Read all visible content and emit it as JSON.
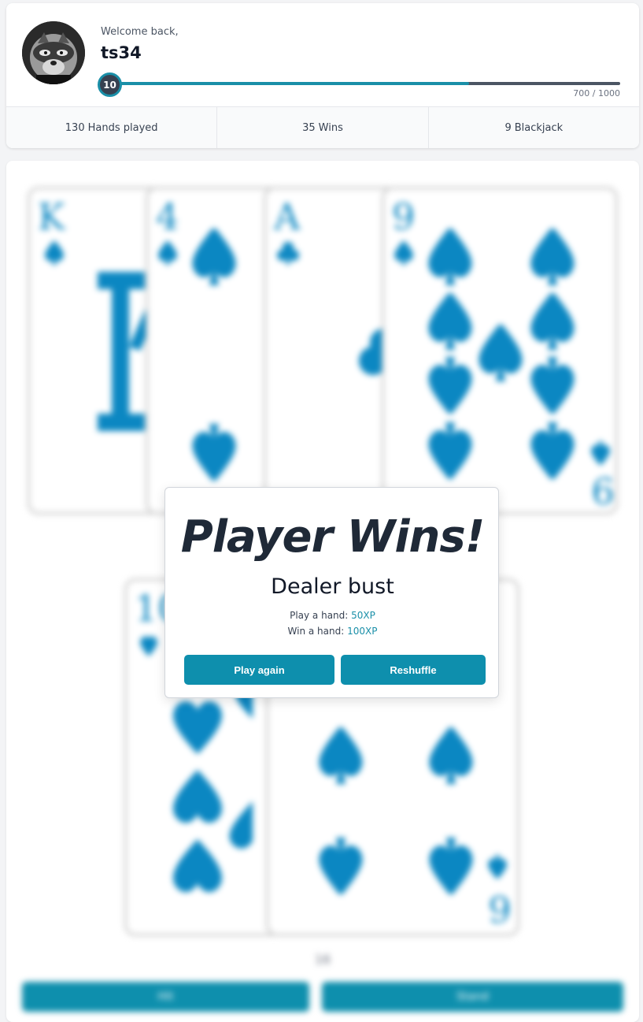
{
  "profile": {
    "welcome": "Welcome back,",
    "username": "ts34",
    "level": "10",
    "xp_current": 700,
    "xp_max": 1000,
    "xp_text": "700 / 1000",
    "avatar_icon": "raccoon-avatar"
  },
  "stats": [
    {
      "value": "130",
      "label": "Hands played"
    },
    {
      "value": "35",
      "label": "Wins"
    },
    {
      "value": "9",
      "label": "Blackjack"
    }
  ],
  "dealer_hand": [
    {
      "rank": "K",
      "suit": "spade"
    },
    {
      "rank": "4",
      "suit": "spade"
    },
    {
      "rank": "A",
      "suit": "club"
    },
    {
      "rank": "9",
      "suit": "spade"
    }
  ],
  "player_hand": [
    {
      "rank": "10",
      "suit": "heart"
    },
    {
      "rank": "6",
      "suit": "spade"
    }
  ],
  "hand_total": "16",
  "actions": {
    "hit_label": "Hit",
    "stand_label": "Stand"
  },
  "result_modal": {
    "title": "Player Wins!",
    "subtitle": "Dealer bust",
    "play_hand_label": "Play a hand:",
    "play_hand_xp": "50XP",
    "win_hand_label": "Win a hand:",
    "win_hand_xp": "100XP",
    "play_again_label": "Play again",
    "reshuffle_label": "Reshuffle"
  },
  "colors": {
    "accent": "#0e8fad",
    "card_ink": "#0b87c2"
  }
}
